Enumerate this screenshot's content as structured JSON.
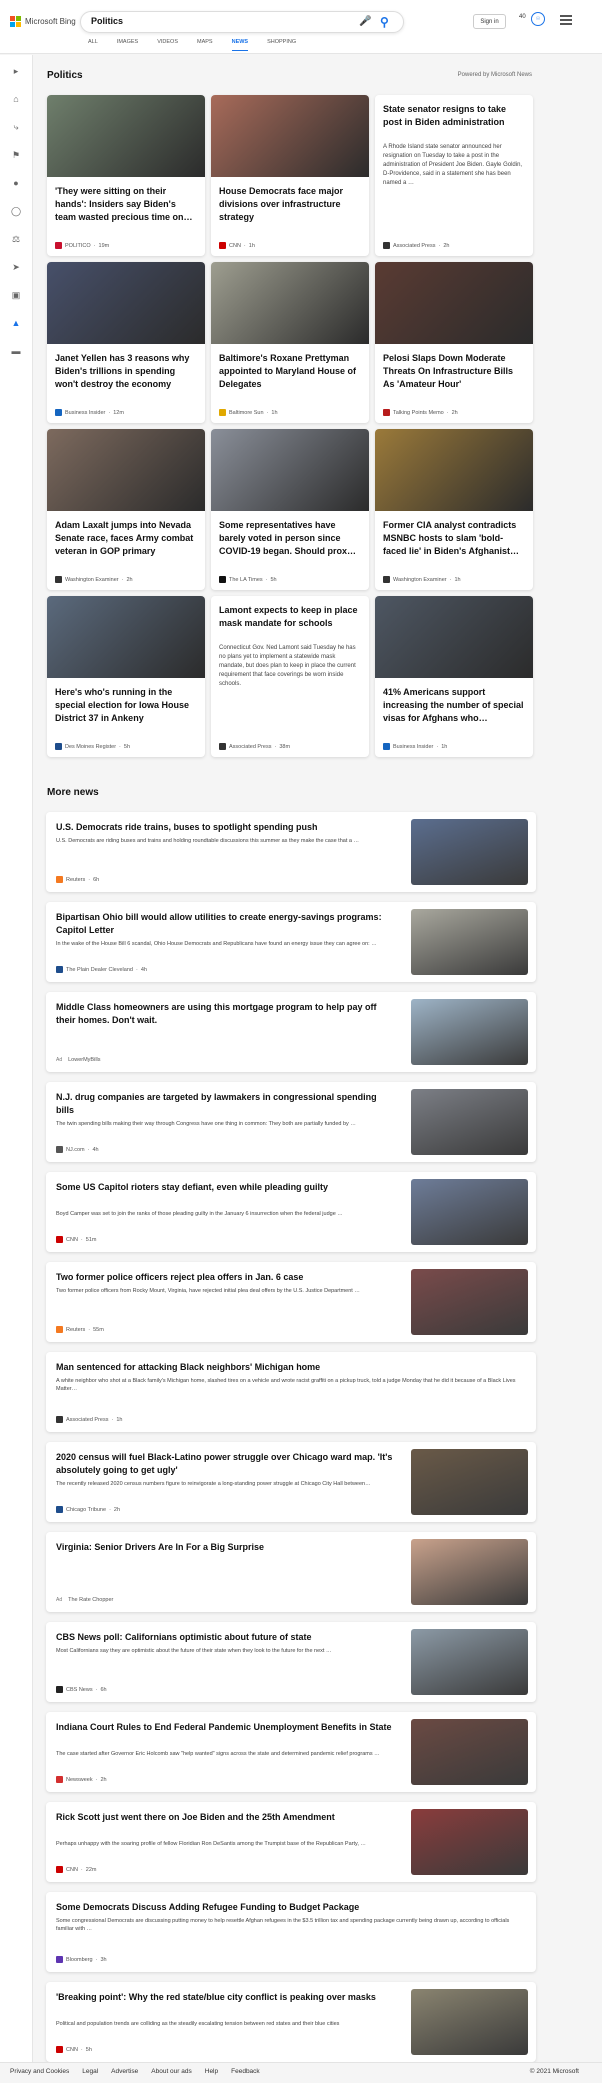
{
  "header": {
    "logo": "Microsoft Bing",
    "query": "Politics",
    "signin": "Sign in",
    "rewards": "40",
    "tabs": [
      "ALL",
      "IMAGES",
      "VIDEOS",
      "MAPS",
      "NEWS",
      "SHOPPING"
    ],
    "active_tab": "NEWS"
  },
  "section": {
    "title": "Politics",
    "powered": "Powered by Microsoft News"
  },
  "cards": [
    {
      "title": "'They were sitting on their hands': Insiders say Biden's team wasted precious time on…",
      "source": "POLITICO",
      "time": "19m",
      "color": "#c8102e",
      "img": "#6f7f6c"
    },
    {
      "title": "House Democrats face major divisions over infrastructure strategy",
      "source": "CNN",
      "time": "1h",
      "color": "#cc0000",
      "img": "#a86b5a"
    },
    {
      "title": "State senator resigns to take post in Biden administration",
      "snippet": "A Rhode Island state senator announced her resignation on Tuesday to take a post in the administration of President Joe Biden. Gayle Goldin, D-Providence, said in a statement she has been named a …",
      "source": "Associated Press",
      "time": "2h",
      "color": "#333333"
    },
    {
      "title": "Janet Yellen has 3 reasons why Biden's trillions in spending won't destroy the economy",
      "source": "Business Insider",
      "time": "12m",
      "color": "#1565c0",
      "img": "#47506a"
    },
    {
      "title": "Baltimore's Roxane Prettyman appointed to Maryland House of Delegates",
      "source": "Baltimore Sun",
      "time": "1h",
      "color": "#e0a800",
      "img": "#9e9e90"
    },
    {
      "title": "Pelosi Slaps Down Moderate Threats On Infrastructure Bills As 'Amateur Hour'",
      "source": "Talking Points Memo",
      "time": "2h",
      "color": "#b71c1c",
      "img": "#5a3b33"
    },
    {
      "title": "Adam Laxalt jumps into Nevada Senate race, faces Army combat veteran in GOP primary",
      "source": "Washington Examiner",
      "time": "2h",
      "color": "#333333",
      "img": "#7d6a5e"
    },
    {
      "title": "Some representatives have barely voted in person since COVID-19 began. Should prox…",
      "source": "The LA Times",
      "time": "5h",
      "color": "#111111",
      "img": "#8a8f99"
    },
    {
      "title": "Former CIA analyst contradicts MSNBC hosts to slam 'bold-faced lie' in Biden's Afghanist…",
      "source": "Washington Examiner",
      "time": "1h",
      "color": "#333333",
      "img": "#9b7a3a"
    },
    {
      "title": "Here's who's running in the special election for Iowa House District 37 in Ankeny",
      "source": "Des Moines Register",
      "time": "5h",
      "color": "#1e4d8c",
      "img": "#5b6a7d"
    },
    {
      "title": "Lamont expects to keep in place mask mandate for schools",
      "snippet": "Connecticut Gov. Ned Lamont said Tuesday he has no plans yet to implement a statewide mask mandate, but does plan to keep in place the current requirement that face coverings be worn inside schools.",
      "source": "Associated Press",
      "time": "38m",
      "color": "#333333"
    },
    {
      "title": "41% Americans support increasing the number of special visas for Afghans who…",
      "source": "Business Insider",
      "time": "1h",
      "color": "#1565c0",
      "img": "#4e5763"
    }
  ],
  "more_title": "More news",
  "more": [
    {
      "title": "U.S. Democrats ride trains, buses to spotlight spending push",
      "snippet": "U.S. Democrats are riding buses and trains and holding roundtable discussions this summer as they make the case that a …",
      "source": "Reuters",
      "time": "6h",
      "color": "#f47920",
      "img": "#5b6e8f"
    },
    {
      "title": "Bipartisan Ohio bill would allow utilities to create energy-savings programs: Capitol Letter",
      "snippet": "In the wake of the House Bill 6 scandal, Ohio House Democrats and Republicans have found an energy issue they can agree on: …",
      "source": "The Plain Dealer Cleveland",
      "time": "4h",
      "color": "#1e4d8c",
      "img": "#a9a89e"
    },
    {
      "title": "Middle Class homeowners are using this mortgage program to help pay off their homes. Don't wait.",
      "snippet": "",
      "source": "LowerMyBills",
      "time": "",
      "ad": "Ad",
      "color": "",
      "img": "#9eb4c7"
    },
    {
      "title": "N.J. drug companies are targeted by lawmakers in congressional spending bills",
      "snippet": "The twin spending bills making their way through Congress have one thing in common: They both are partially funded by …",
      "source": "NJ.com",
      "time": "4h",
      "color": "#555555",
      "img": "#7c7f86"
    },
    {
      "title": "Some US Capitol rioters stay defiant, even while pleading guilty",
      "snippet": "Boyd Camper was set to join the ranks of those pleading guilty in the January 6 insurrection when the federal judge …",
      "source": "CNN",
      "time": "51m",
      "color": "#cc0000",
      "img": "#6e7d99"
    },
    {
      "title": "Two former police officers reject plea offers in Jan. 6 case",
      "snippet": "Two former police officers from Rocky Mount, Virginia, have rejected initial plea deal offers by the U.S. Justice Department …",
      "source": "Reuters",
      "time": "55m",
      "color": "#f47920",
      "img": "#7a4b4b"
    },
    {
      "title": "Man sentenced for attacking Black neighbors' Michigan home",
      "snippet": "A white neighbor who shot at a Black family's Michigan home, slashed tires on a vehicle and wrote racist graffiti on a pickup truck, told a judge Monday that he did it because of a Black Lives Matter…",
      "source": "Associated Press",
      "time": "1h",
      "color": "#333333"
    },
    {
      "title": "2020 census will fuel Black-Latino power struggle over Chicago ward map. 'It's absolutely going to get ugly'",
      "snippet": "The recently released 2020 census numbers figure to reinvigorate a long-standing power struggle at Chicago City Hall between…",
      "source": "Chicago Tribune",
      "time": "2h",
      "color": "#1e4d8c",
      "img": "#6a5a48"
    },
    {
      "title": "Virginia: Senior Drivers Are In For a Big Surprise",
      "snippet": "",
      "source": "The Rate Chopper",
      "time": "",
      "ad": "Ad",
      "color": "",
      "img": "#c9a28c"
    },
    {
      "title": "CBS News poll: Californians optimistic about future of state",
      "snippet": "Most Californians say they are optimistic about the future of their state when they look to the future for the next …",
      "source": "CBS News",
      "time": "6h",
      "color": "#222222",
      "img": "#8c9aa6"
    },
    {
      "title": "Indiana Court Rules to End Federal Pandemic Unemployment Benefits in State",
      "snippet": "The case started after Governor Eric Holcomb saw \"help wanted\" signs across the state and determined pandemic relief programs …",
      "source": "Newsweek",
      "time": "2h",
      "color": "#d32f2f",
      "img": "#6b4a43"
    },
    {
      "title": "Rick Scott just went there on Joe Biden and the 25th Amendment",
      "snippet": "Perhaps unhappy with the soaring profile of fellow Floridian Ron DeSantis among the Trumpist base of the Republican Party, …",
      "source": "CNN",
      "time": "22m",
      "color": "#cc0000",
      "img": "#8a3c3c"
    },
    {
      "title": "Some Democrats Discuss Adding Refugee Funding to Budget Package",
      "snippet": "Some congressional Democrats are discussing putting money to help resettle Afghan refugees in the $3.5 trillion tax and spending package currently being drawn up, according to officials familiar with …",
      "source": "Bloomberg",
      "time": "3h",
      "color": "#5e35b1"
    },
    {
      "title": "'Breaking point': Why the red state/blue city conflict is peaking over masks",
      "snippet": "Political and population trends are colliding as the steadily escalating tension between red states and their blue cities",
      "source": "CNN",
      "time": "5h",
      "color": "#cc0000",
      "img": "#8a8470"
    }
  ],
  "footer": {
    "links": [
      "Privacy and Cookies",
      "Legal",
      "Advertise",
      "About our ads",
      "Help",
      "Feedback"
    ],
    "copyright": "© 2021 Microsoft"
  }
}
